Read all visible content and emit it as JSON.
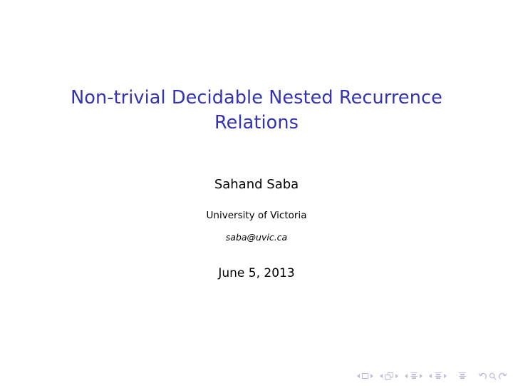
{
  "slide": {
    "kind": "beamer-title-slide",
    "background_color": "#ffffff",
    "title_color": "#3333b2",
    "text_color": "#000000",
    "nav_color": "#bcbce0"
  },
  "titlepage": {
    "title": "Non-trivial Decidable Nested Recurrence Relations",
    "author": "Sahand Saba",
    "institute": "University of Victoria",
    "email": "saba@uvic.ca",
    "date": "June 5, 2013"
  },
  "navigation": {
    "groups": [
      {
        "icon": "slide-icon",
        "prev_label": "previous-slide",
        "next_label": "next-slide"
      },
      {
        "icon": "frame-icon",
        "prev_label": "previous-frame",
        "next_label": "next-frame"
      },
      {
        "icon": "subsection-icon",
        "prev_label": "previous-subsection",
        "next_label": "next-subsection"
      },
      {
        "icon": "section-icon",
        "prev_label": "previous-section",
        "next_label": "next-section"
      }
    ],
    "document_icon": "document-icon",
    "back_icon": "back-arrow-icon",
    "find_icon": "search-icon",
    "forward_icon": "forward-arrow-icon"
  }
}
